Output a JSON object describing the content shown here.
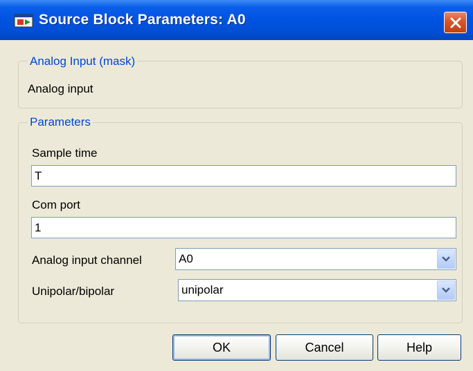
{
  "dialog": {
    "title": "Source Block Parameters: A0",
    "close_label": "×"
  },
  "description_group": {
    "legend": "Analog Input (mask)",
    "text": "Analog input"
  },
  "parameters_group": {
    "legend": "Parameters",
    "sample_time": {
      "label": "Sample time",
      "value": "T"
    },
    "com_port": {
      "label": "Com port",
      "value": "1"
    },
    "analog_input_channel": {
      "label": "Analog input channel",
      "value": "A0"
    },
    "unipolar_bipolar": {
      "label": "Unipolar/bipolar",
      "value": "unipolar"
    }
  },
  "buttons": {
    "ok": "OK",
    "cancel": "Cancel",
    "help": "Help"
  },
  "colors": {
    "titlebar": "#0054e3",
    "legend_text": "#0046d5",
    "dialog_face": "#ece9d8",
    "close_button": "#d9542a"
  },
  "icons": {
    "app": "simulink-block-icon",
    "close": "close-icon",
    "dropdown": "chevron-down-icon"
  }
}
